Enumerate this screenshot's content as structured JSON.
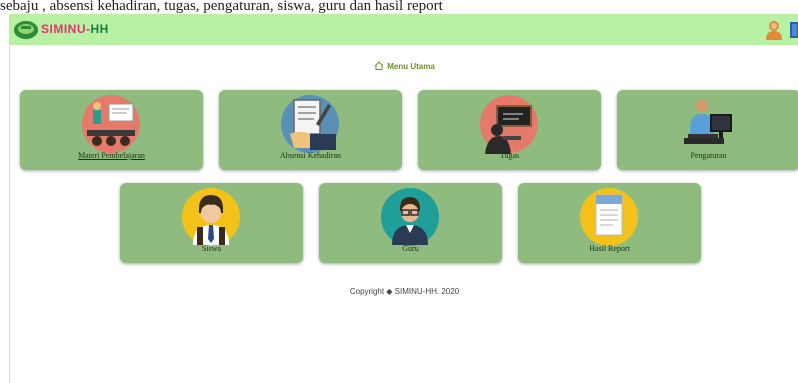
{
  "caption": "sebaju , absensi kehadiran, tugas, pengaturan, siswa, guru dan hasil report",
  "header": {
    "brand_part1": "SIMINU-",
    "brand_part2": "HH"
  },
  "menu_title": "Menu Utama",
  "cards": [
    {
      "label": "Materi Pembelajaran",
      "icon": "teacher-presentation-icon"
    },
    {
      "label": "Absensi Kehadiran",
      "icon": "attendance-clipboard-icon"
    },
    {
      "label": "Tugas",
      "icon": "assignment-blackboard-icon"
    },
    {
      "label": "Pengaturan",
      "icon": "settings-computer-user-icon"
    },
    {
      "label": "Siswa",
      "icon": "student-avatar-icon"
    },
    {
      "label": "Guru",
      "icon": "teacher-avatar-icon"
    },
    {
      "label": "Hasil Report",
      "icon": "report-document-icon"
    }
  ],
  "footer": {
    "copyright": "Copyright ◆ SIMINU-HH. 2020"
  },
  "colors": {
    "topbar": "#b8f0a4",
    "card": "#8fbb7e",
    "title_accent": "#6b8f2a"
  }
}
